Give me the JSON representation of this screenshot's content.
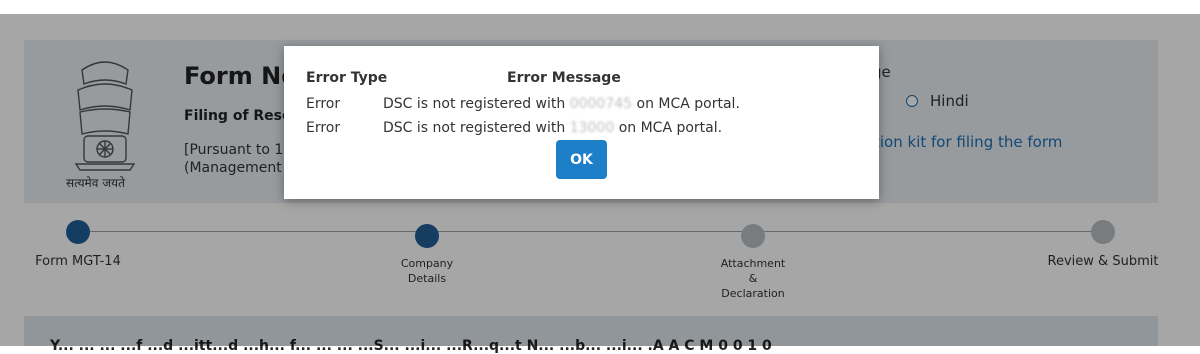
{
  "form": {
    "title": "Form No",
    "subtitle": "Filing of Resolu",
    "pursuant": "[Pursuant to 117(\n(Management a",
    "emblem_caption": "सत्यमेव जयते",
    "language_label": "ge",
    "hindi_option": "Hindi",
    "kit_link": "tion kit for filing the form"
  },
  "stepper": {
    "steps": [
      {
        "label": "Form MGT-14",
        "state": "done"
      },
      {
        "label": "Company\nDetails",
        "state": "done"
      },
      {
        "label": "Attachment\n&\nDeclaration",
        "state": "todo"
      },
      {
        "label": "Review & Submit",
        "state": "todo"
      }
    ]
  },
  "bottom": {
    "text": "Y... ... ... ...f ...d ...itt...d ...h... f... ... ... ...S... ...i... ...R...q...t N... ...b... ...i... .A A C M 0 0 1 0"
  },
  "modal": {
    "header_type": "Error Type",
    "header_message": "Error Message",
    "rows": [
      {
        "type": "Error",
        "message_pre": "DSC is not registered with ",
        "message_redacted": "0000745",
        "message_post": " on MCA portal."
      },
      {
        "type": "Error",
        "message_pre": "DSC is not registered with ",
        "message_redacted": "13000",
        "message_post": " on MCA portal."
      }
    ],
    "ok_label": "OK"
  },
  "colors": {
    "primary": "#1c7fc8",
    "step_done": "#1f5f96",
    "step_todo": "#b9bfc4",
    "link": "#1f6fb6"
  },
  "icons": {
    "emblem": "national-emblem-icon"
  }
}
